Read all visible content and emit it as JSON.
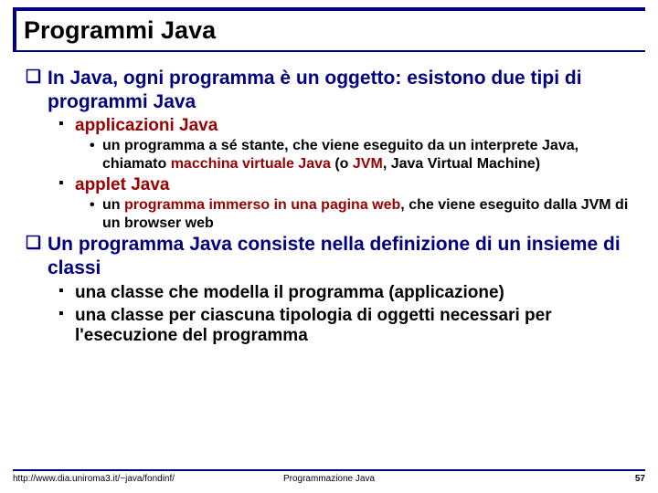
{
  "title": "Programmi Java",
  "b1a": "In Java, ogni programma è un oggetto: esistono due tipi di programmi Java",
  "b2a": "applicazioni Java",
  "b3a_pre": "un programma a sé stante, che viene eseguito da un interprete Java, chiamato ",
  "b3a_hl1": "macchina virtuale Java",
  "b3a_mid": " (o ",
  "b3a_hl2": "JVM",
  "b3a_post": ", Java Virtual Machine)",
  "b2b": "applet Java",
  "b3b_pre": "un ",
  "b3b_hl": "programma immerso in una pagina web",
  "b3b_post": ", che viene eseguito dalla JVM di un browser web",
  "b1b": "Un programma Java consiste nella definizione di un insieme di classi",
  "b2c": "una classe che modella il programma (applicazione)",
  "b2d": "una classe per ciascuna tipologia di oggetti necessari per l'esecuzione del programma",
  "footer_left": "http://www.dia.uniroma3.it/~java/fondinf/",
  "footer_center": "Programmazione Java",
  "footer_right": "57"
}
